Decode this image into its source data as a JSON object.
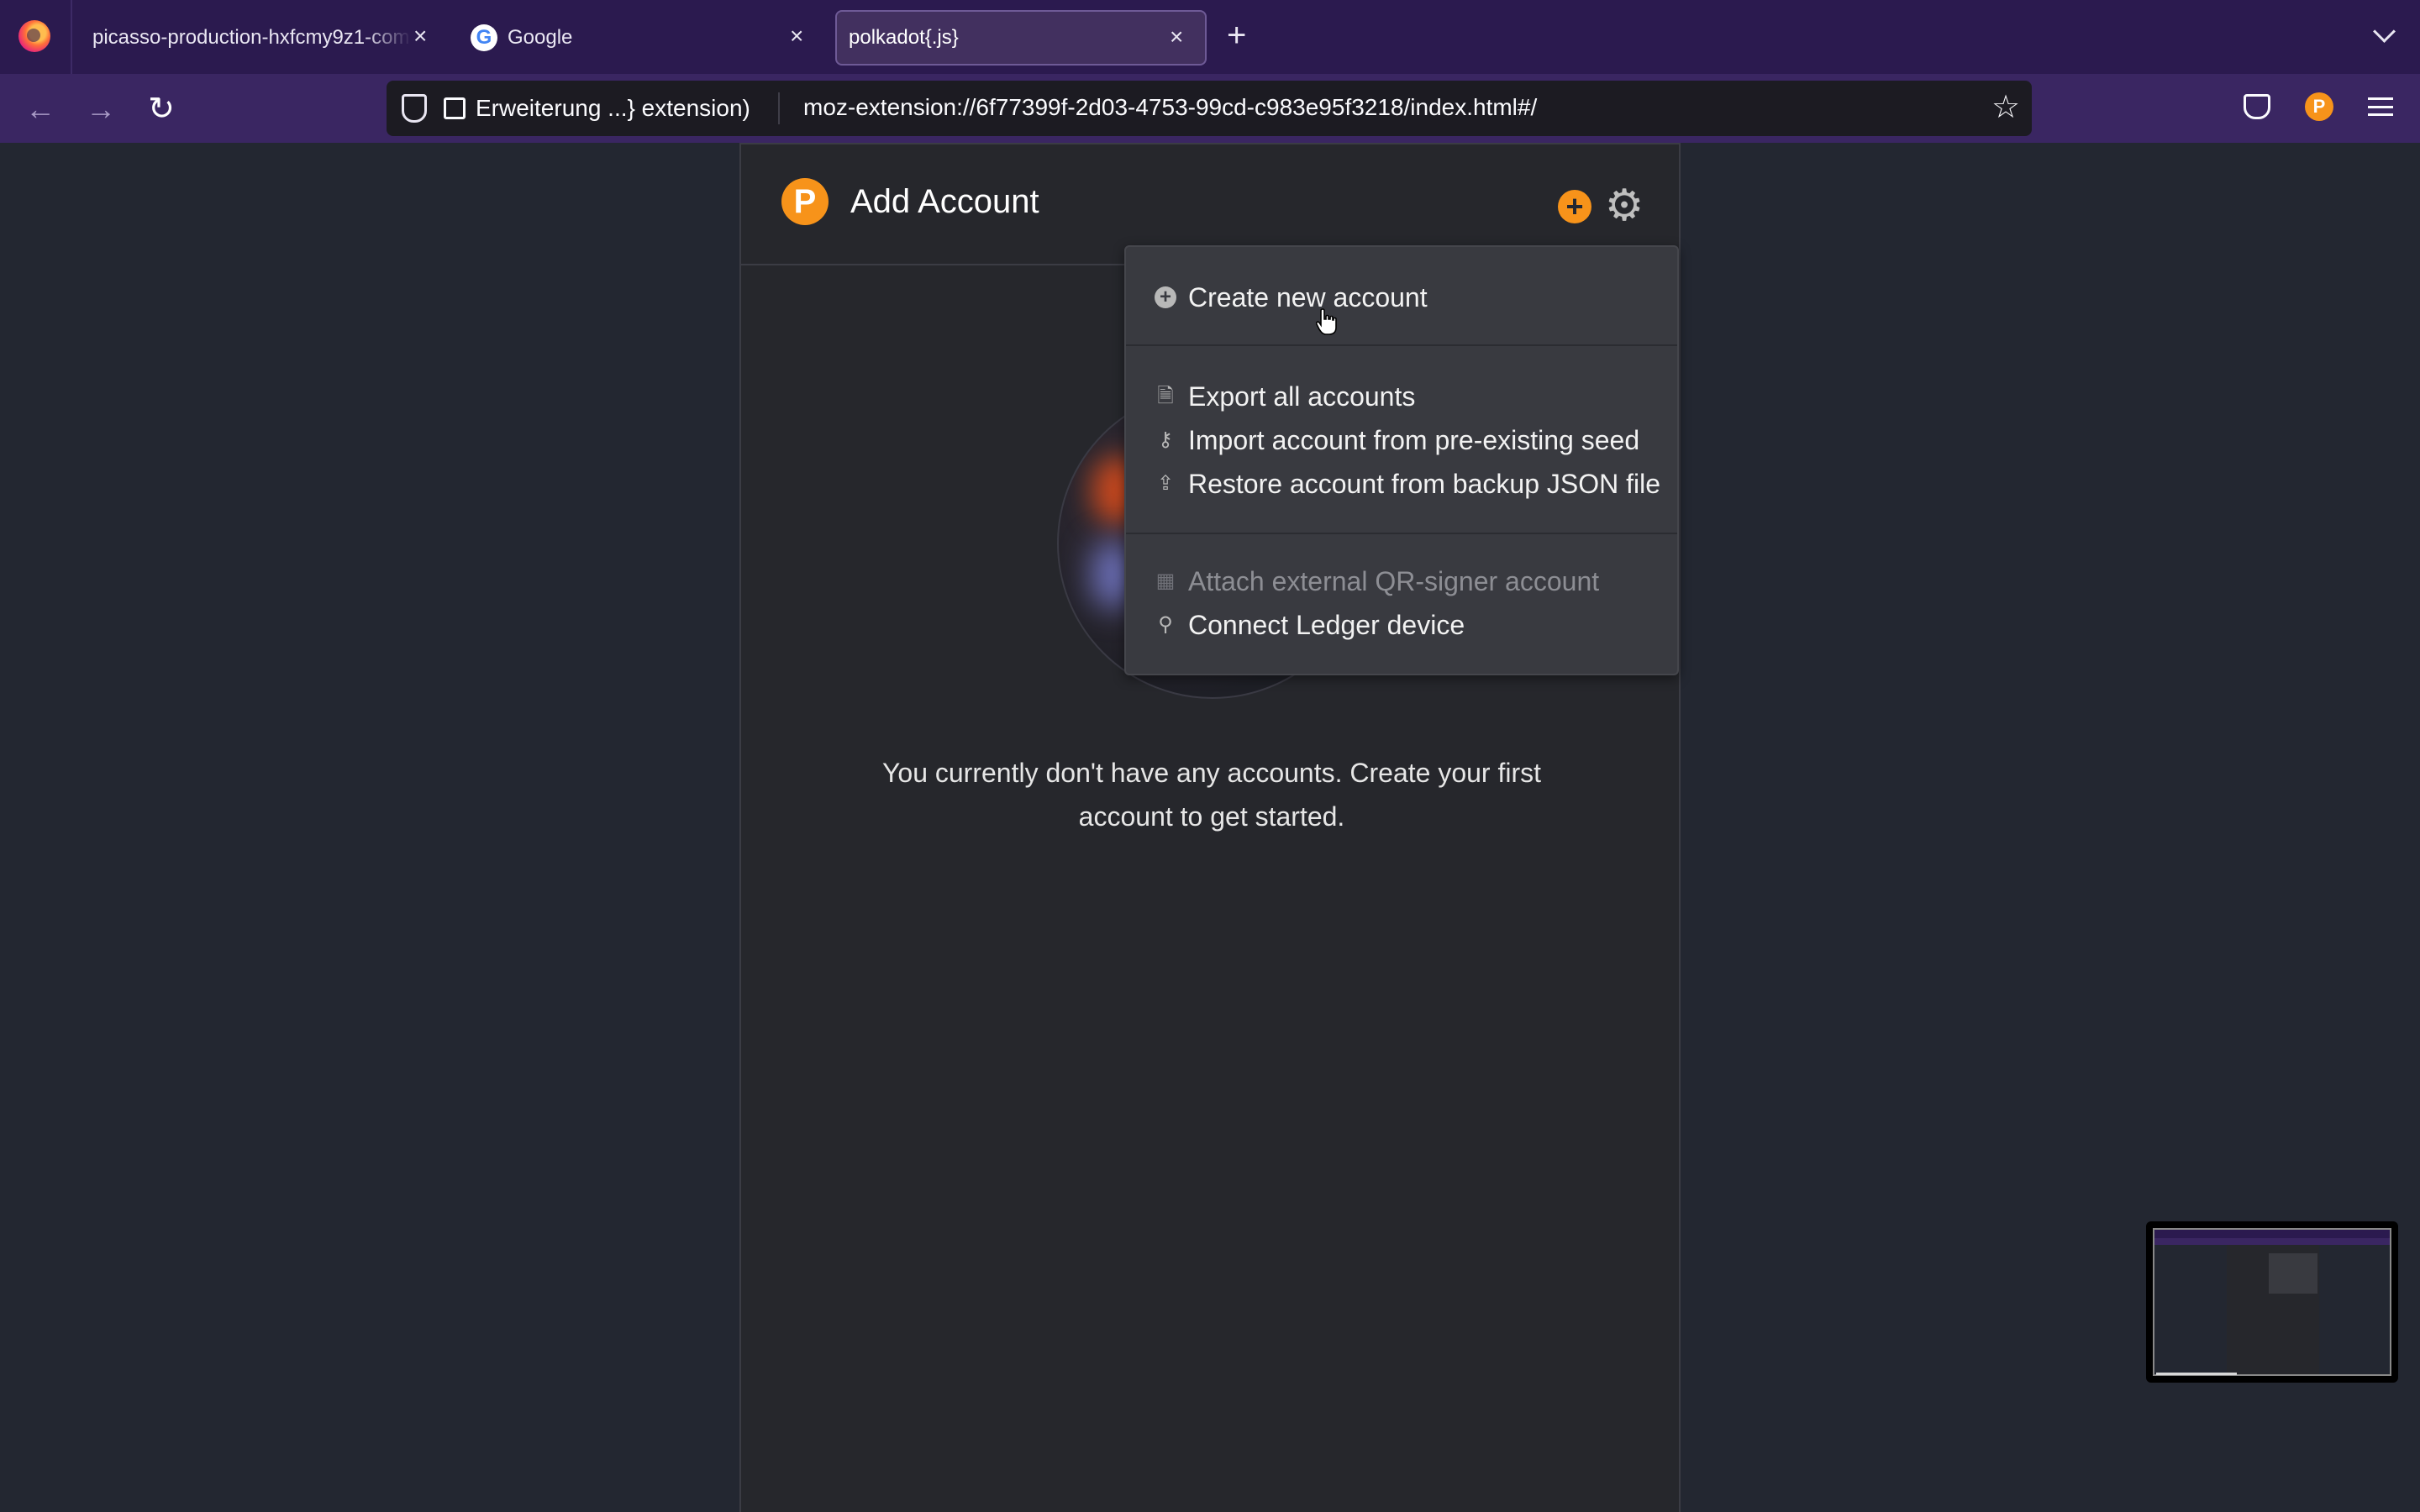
{
  "browser": {
    "tabs": [
      {
        "title": "picasso-production-hxfcmy9z1-com",
        "active": false
      },
      {
        "title": "Google",
        "active": false
      },
      {
        "title": "polkadot{.js}",
        "active": true
      }
    ],
    "identity_chip": "Erweiterung ...} extension)",
    "url": "moz-extension://6f77399f-2d03-4753-99cd-c983e95f3218/index.html#/"
  },
  "popup": {
    "logo_letter": "P",
    "title": "Add Account",
    "empty_message": "You currently don't have any accounts. Create your first account to get started.",
    "accent_color": "#f7931a"
  },
  "menu": {
    "items": [
      {
        "label": "Create new account",
        "icon": "plus-circle-icon",
        "enabled": true
      },
      {
        "label": "Export all accounts",
        "icon": "file-export-icon",
        "enabled": true
      },
      {
        "label": "Import account from pre-existing seed",
        "icon": "key-icon",
        "enabled": true
      },
      {
        "label": "Restore account from backup JSON file",
        "icon": "file-upload-icon",
        "enabled": true
      },
      {
        "label": "Attach external QR-signer account",
        "icon": "qrcode-icon",
        "enabled": false
      },
      {
        "label": "Connect Ledger device",
        "icon": "usb-icon",
        "enabled": true
      }
    ]
  }
}
